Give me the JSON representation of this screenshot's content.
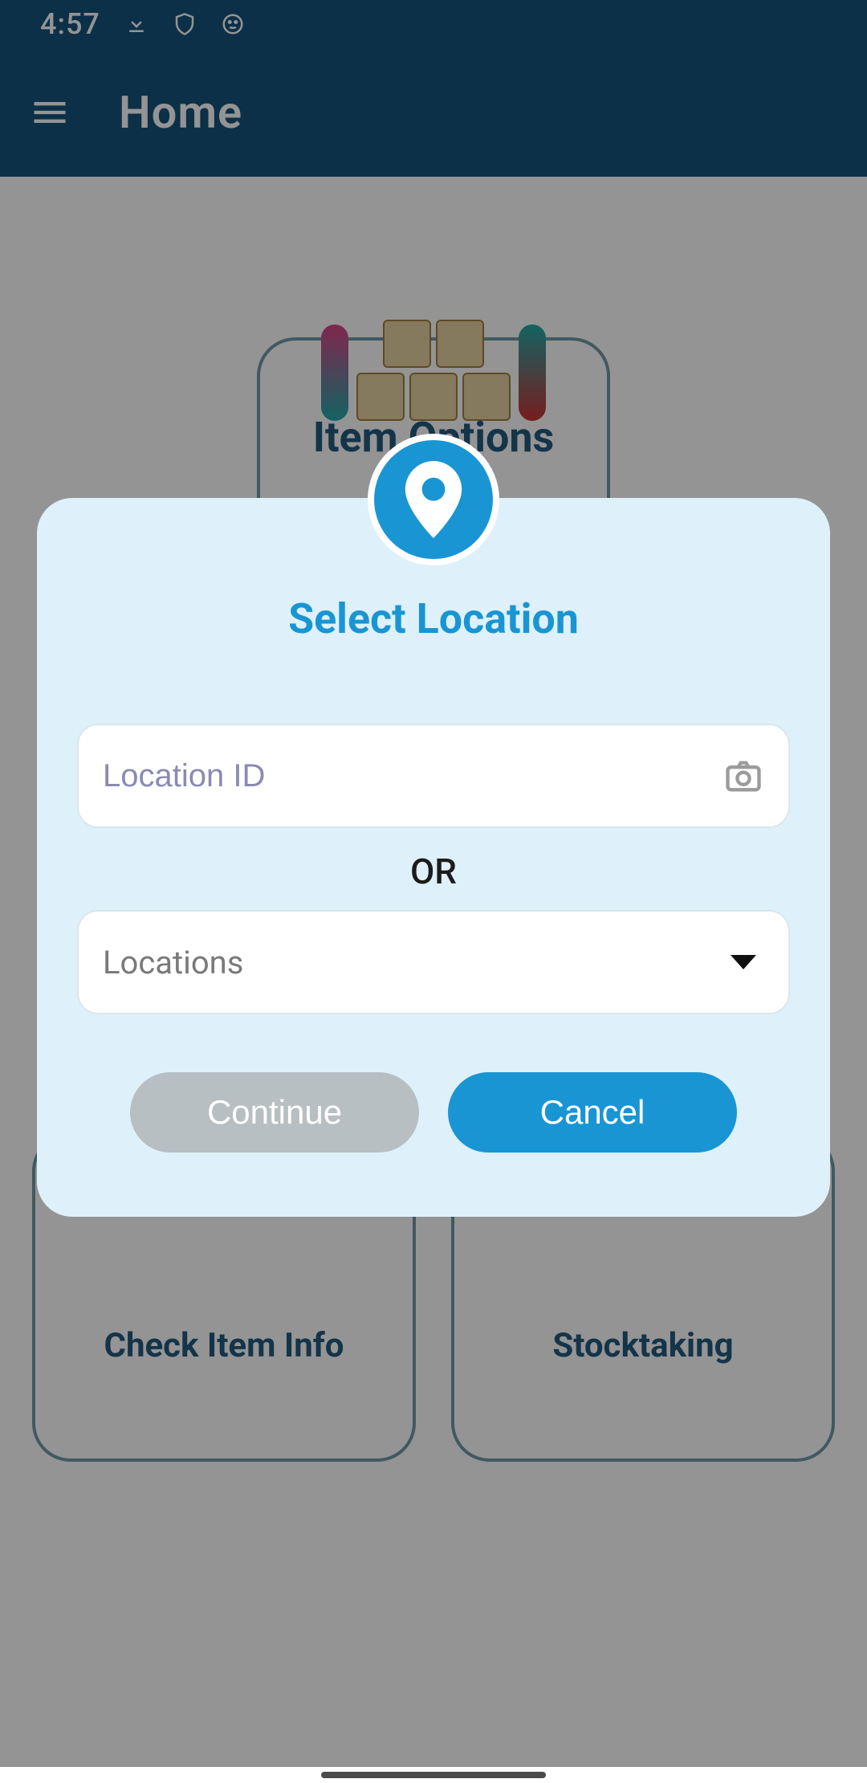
{
  "status": {
    "time": "4:57"
  },
  "appbar": {
    "title": "Home"
  },
  "cards": {
    "big": "Item Options",
    "info": "Check Item Info",
    "stock": "Stocktaking"
  },
  "dialog": {
    "title": "Select Location",
    "location_placeholder": "Location ID",
    "or": "OR",
    "select_label": "Locations",
    "continue": "Continue",
    "cancel": "Cancel"
  },
  "colors": {
    "appbar_bg": "#14537a",
    "accent": "#1a95d3",
    "dialog_bg": "#def1fb"
  }
}
